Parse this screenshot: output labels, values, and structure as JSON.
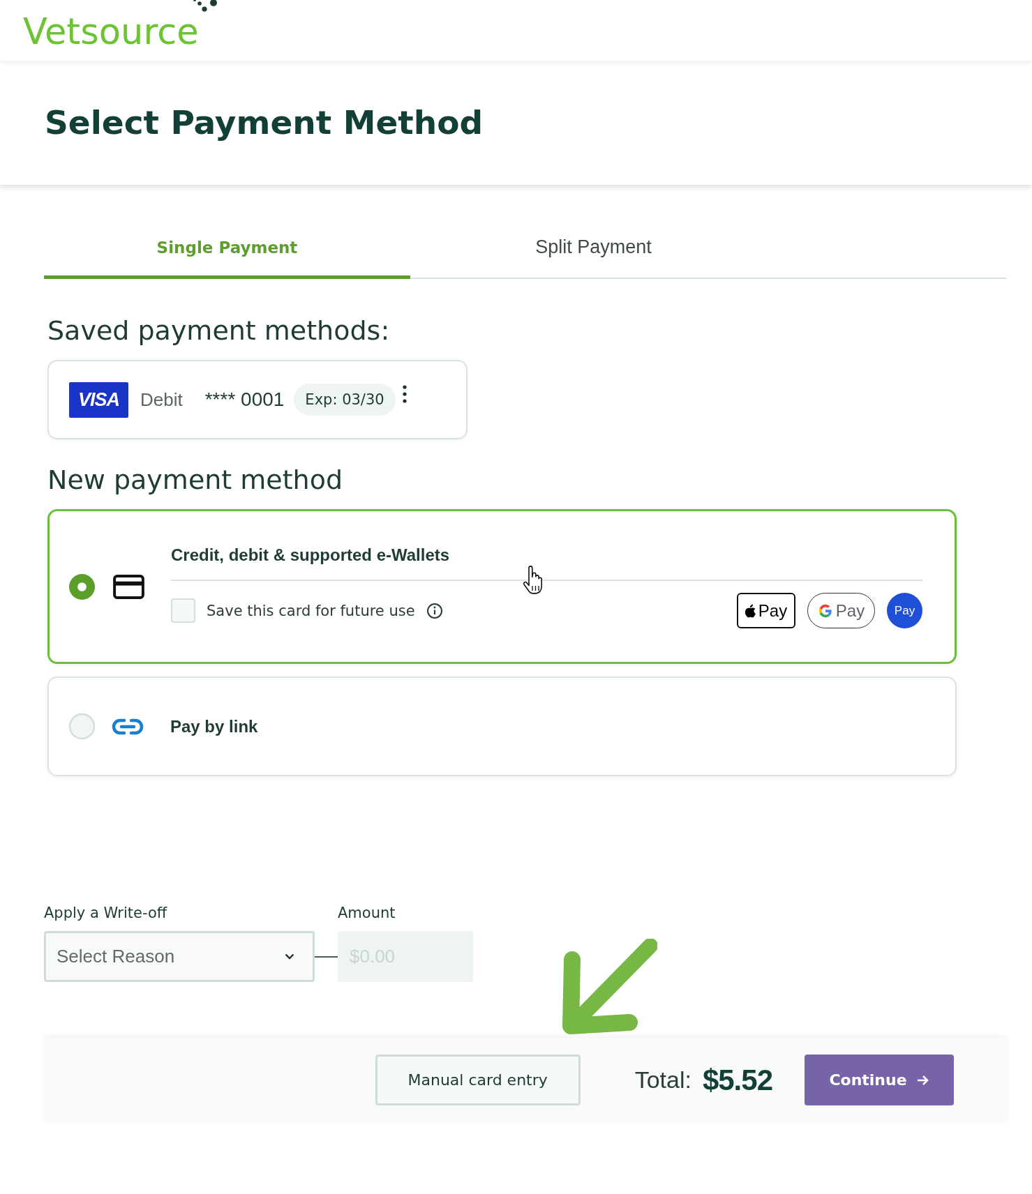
{
  "header": {
    "logo": "Vetsource"
  },
  "page_title": "Select Payment Method",
  "tabs": [
    {
      "label": "Single Payment",
      "selected": true
    },
    {
      "label": "Split Payment",
      "selected": false
    }
  ],
  "saved_methods": {
    "heading": "Saved payment methods:",
    "cards": [
      {
        "brand": "VISA",
        "type": "Debit",
        "number": "**** 0001",
        "expiry": "Exp: 03/30"
      }
    ]
  },
  "new_methods": {
    "heading": "New payment method",
    "options": [
      {
        "kind": "card",
        "label": "Credit, debit & supported e-Wallets",
        "selected": true,
        "save_card": {
          "label": "Save this card for future use",
          "checked": false
        },
        "wallets": [
          {
            "kind": "apple",
            "label": "Pay"
          },
          {
            "kind": "google",
            "label": "Pay"
          },
          {
            "kind": "samsung",
            "label": "Pay"
          }
        ]
      },
      {
        "kind": "link",
        "label": "Pay by link",
        "selected": false
      }
    ]
  },
  "write_off": {
    "reason": {
      "label": "Apply a Write-off",
      "placeholder": "Select Reason"
    },
    "amount": {
      "label": "Amount",
      "placeholder": "$0.00",
      "disabled": true
    }
  },
  "footer": {
    "manual_button": "Manual card entry",
    "total_label": "Total:",
    "total_value": "$5.52",
    "continue_button": "Continue"
  }
}
